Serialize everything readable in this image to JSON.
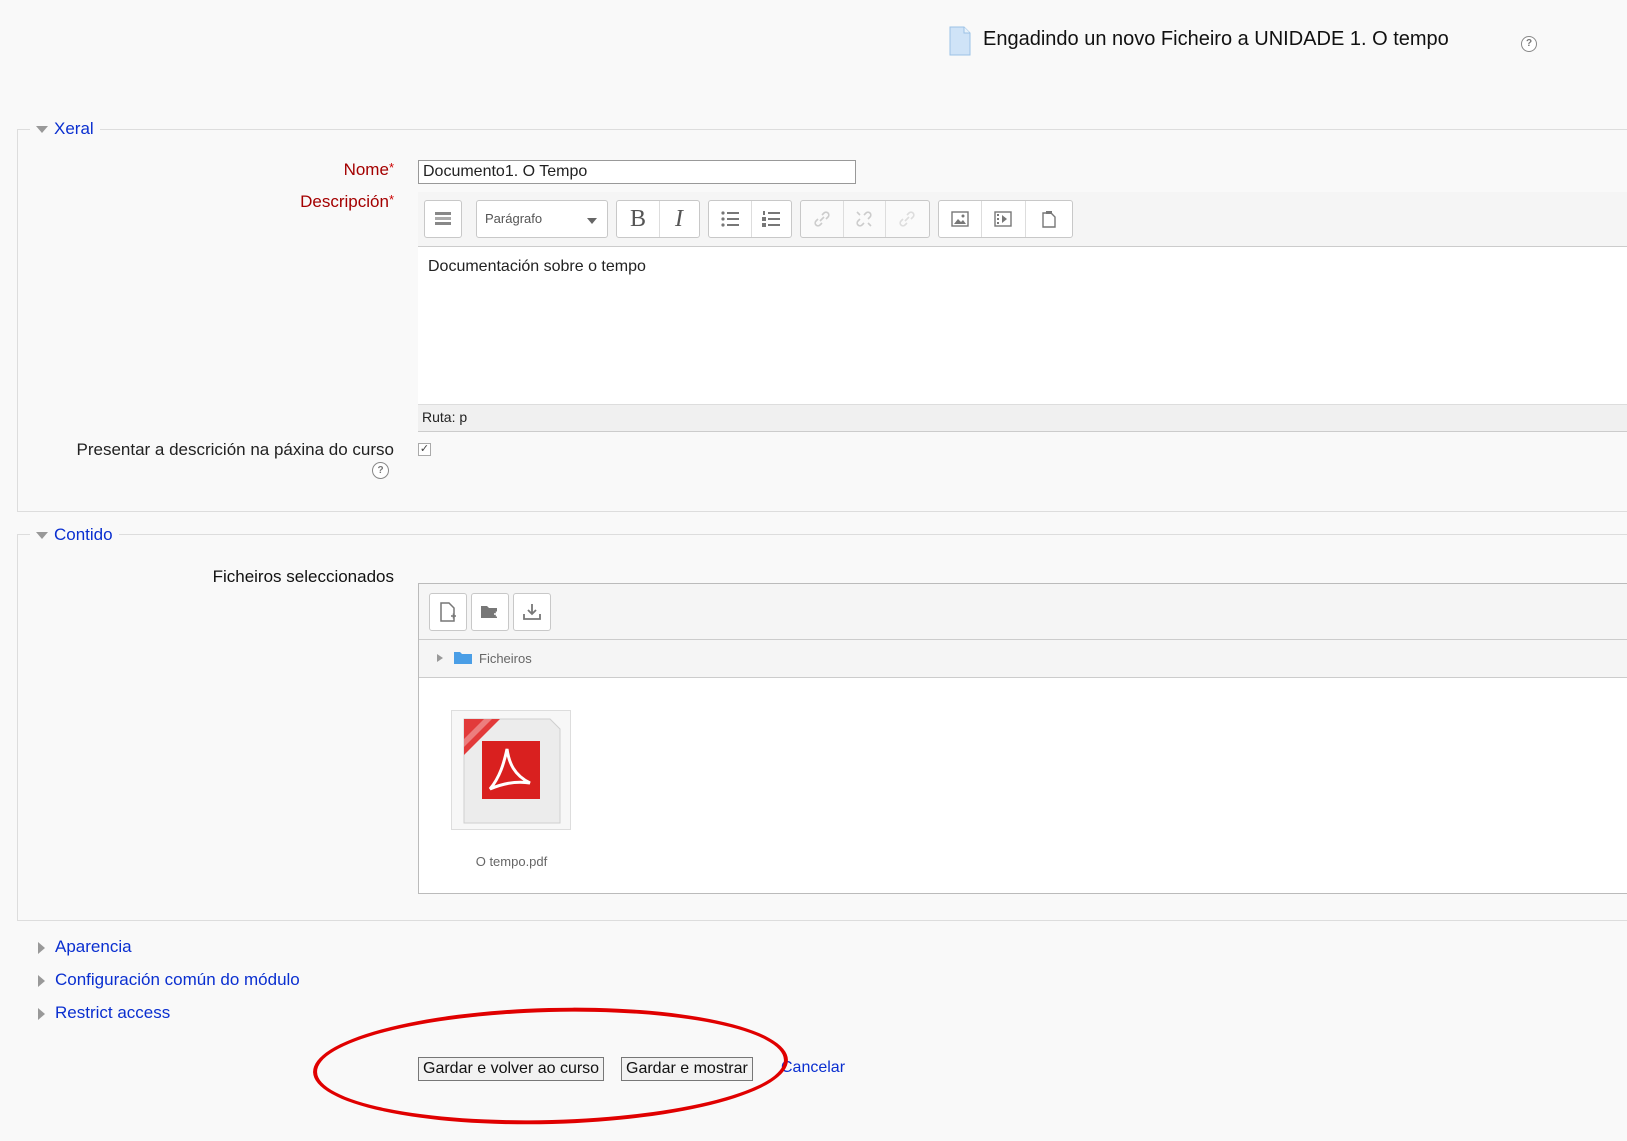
{
  "header": {
    "title": "Engadindo un novo Ficheiro a UNIDADE 1. O tempo",
    "help": "?"
  },
  "general": {
    "legend": "Xeral",
    "name_label": "Nome",
    "required_mark": "*",
    "name_value": "Documento1. O Tempo",
    "description_label": "Descripción",
    "editor": {
      "paragraph_select": "Parágrafo",
      "bold": "B",
      "italic": "I",
      "content": "Documentación sobre o tempo",
      "path": "Ruta: p"
    },
    "show_description_label": "Presentar a descrición na páxina do curso",
    "show_description_checked": true
  },
  "content": {
    "legend": "Contido",
    "files_label": "Ficheiros seleccionados",
    "folder_path": "Ficheiros",
    "file_name": "O tempo.pdf"
  },
  "collapsed_sections": [
    "Aparencia",
    "Configuración común do módulo",
    "Restrict access"
  ],
  "buttons": {
    "save_return": "Gardar e volver ao curso",
    "save_display": "Gardar e mostrar",
    "cancel": "Cancelar"
  },
  "colors": {
    "link": "#0a2fd0",
    "required": "#a40000",
    "annotation": "#e00000",
    "pdf": "#d9201f"
  }
}
